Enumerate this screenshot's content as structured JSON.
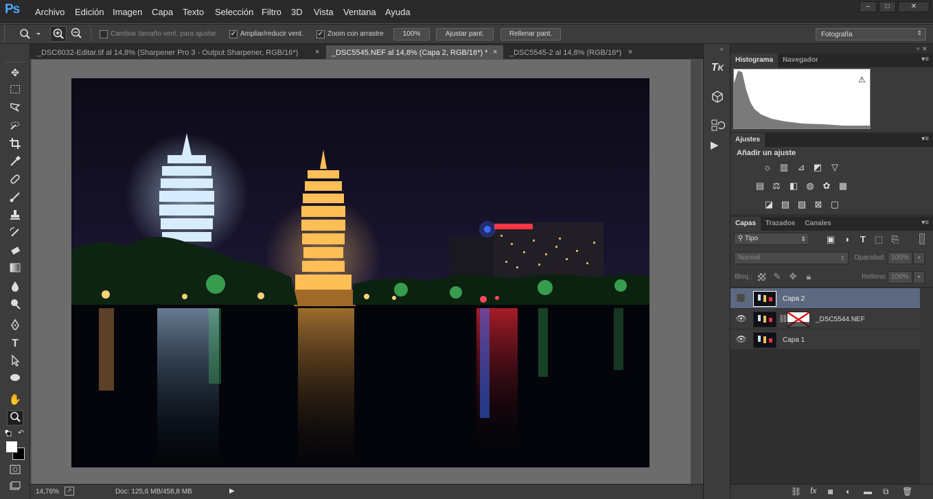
{
  "app": {
    "logo": "Ps"
  },
  "menu": [
    "Archivo",
    "Edición",
    "Imagen",
    "Capa",
    "Texto",
    "Selección",
    "Filtro",
    "3D",
    "Vista",
    "Ventana",
    "Ayuda"
  ],
  "window_controls": {
    "minimize": "–",
    "maximize": "□",
    "close": "✕"
  },
  "options": {
    "resize_windows_label": "Cambiar tamaño vent. para ajustar",
    "resize_windows_checked": false,
    "zoom_all_label": "Ampliar/reducir vent.",
    "zoom_all_checked": true,
    "scrubby_label": "Zoom con arrastre",
    "scrubby_checked": true,
    "btn_100": "100%",
    "btn_fit": "Ajustar pant.",
    "btn_fill": "Rellenar pant.",
    "workspace": "Fotografía"
  },
  "doc_tabs": [
    {
      "label": "_DSC6032-Editar.tif al 14,8% (Sharpener Pro 3 - Output Sharpener, RGB/16*)",
      "close": "×",
      "active": false
    },
    {
      "label": "_DSC5545.NEF al 14,8% (Capa 2, RGB/16*) *",
      "close": "×",
      "active": true
    },
    {
      "label": "_DSC5545-2 al 14,8% (RGB/16*)",
      "close": "×",
      "active": false
    }
  ],
  "status": {
    "zoom": "14,76%",
    "doc": "Doc: 125,6 MB/458,8 MB"
  },
  "panels": {
    "histogram_tabs": [
      "Histograma",
      "Navegador"
    ],
    "adjust_tab": "Ajustes",
    "adjust_title": "Añadir un ajuste",
    "layers_tabs": [
      "Capas",
      "Trazados",
      "Canales"
    ],
    "filter_kind": "Tipo",
    "blend_mode": "Normal",
    "opacity_label": "Opacidad:",
    "opacity_value": "100%",
    "lock_label": "Bloq.:",
    "fill_label": "Relleno:",
    "fill_value": "100%"
  },
  "layers": [
    {
      "name": "Capa 2",
      "visible": false,
      "selected": true
    },
    {
      "name": "_DSC5544.NEF",
      "visible": true,
      "selected": false
    },
    {
      "name": "Capa 1",
      "visible": true,
      "selected": false
    }
  ]
}
